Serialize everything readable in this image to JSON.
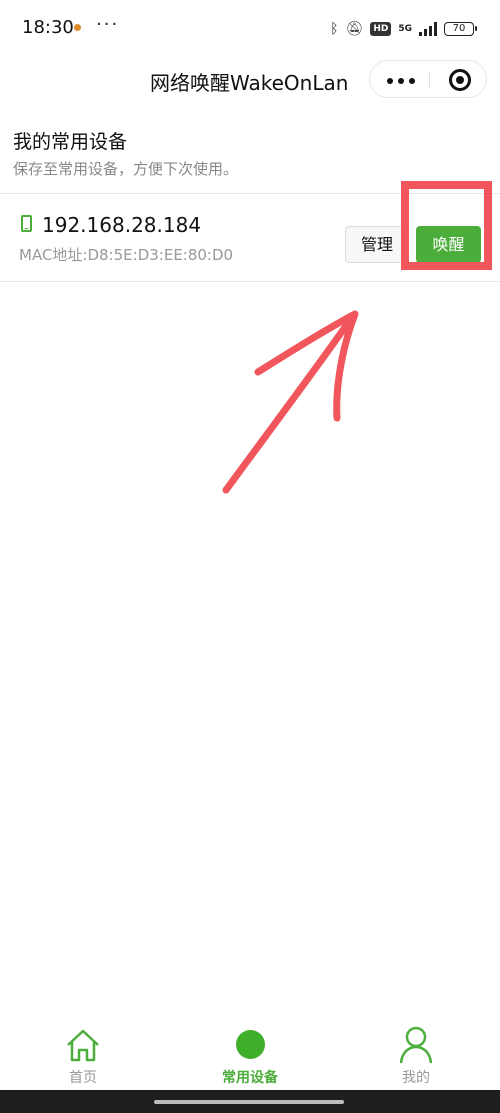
{
  "status_bar": {
    "time": "18:30",
    "more": "···",
    "hd": "HD",
    "network": "5G",
    "battery": "70"
  },
  "nav": {
    "title": "网络唤醒WakeOnLan"
  },
  "section": {
    "title": "我的常用设备",
    "subtitle": "保存至常用设备，方便下次使用。"
  },
  "devices": [
    {
      "ip": "192.168.28.184",
      "mac": "MAC地址:D8:5E:D3:EE:80:D0",
      "manage_label": "管理",
      "wake_label": "唤醒"
    }
  ],
  "tabs": [
    {
      "label": "首页",
      "icon": "home-icon",
      "active": false
    },
    {
      "label": "常用设备",
      "icon": "circle-icon",
      "active": true
    },
    {
      "label": "我的",
      "icon": "user-icon",
      "active": false
    }
  ],
  "colors": {
    "accent": "#4cae3a",
    "annotation": "#f0565b"
  }
}
